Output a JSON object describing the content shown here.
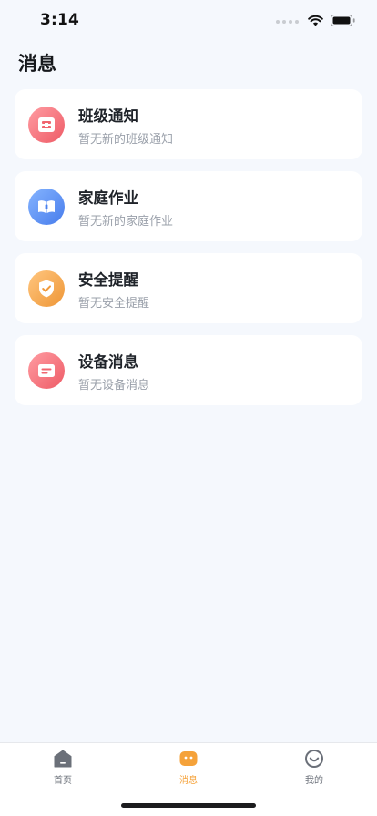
{
  "status_bar": {
    "time": "3:14"
  },
  "page": {
    "title": "消息"
  },
  "cards": [
    {
      "title": "班级通知",
      "subtitle": "暂无新的班级通知",
      "icon": "class-notice-icon",
      "color_from": "#ff9aa0",
      "color_to": "#ef5e68"
    },
    {
      "title": "家庭作业",
      "subtitle": "暂无新的家庭作业",
      "icon": "homework-book-icon",
      "color_from": "#7fb0ff",
      "color_to": "#4a80ee"
    },
    {
      "title": "安全提醒",
      "subtitle": "暂无安全提醒",
      "icon": "safety-shield-icon",
      "color_from": "#ffc27a",
      "color_to": "#f09a3c"
    },
    {
      "title": "设备消息",
      "subtitle": "暂无设备消息",
      "icon": "device-card-icon",
      "color_from": "#ff9aa0",
      "color_to": "#ef5e68"
    }
  ],
  "tab_bar": {
    "tabs": [
      {
        "label": "首页",
        "icon": "home-icon",
        "active": false
      },
      {
        "label": "消息",
        "icon": "message-icon",
        "active": true
      },
      {
        "label": "我的",
        "icon": "profile-icon",
        "active": false
      }
    ],
    "active_color": "#f5a23a",
    "inactive_color": "#6b7079"
  }
}
